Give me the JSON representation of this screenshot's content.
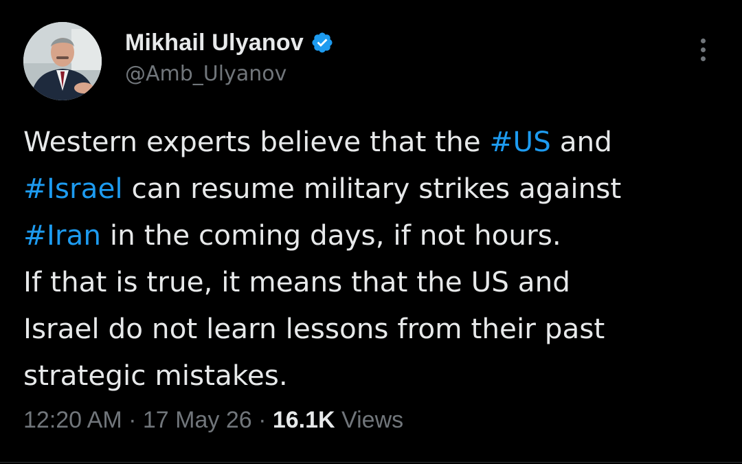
{
  "author": {
    "display_name": "Mikhail Ulyanov",
    "handle": "@Amb_Ulyanov",
    "verified_color": "#1d9bf0"
  },
  "tweet": {
    "lines": [
      [
        {
          "text": "Western experts believe that the ",
          "type": "text"
        },
        {
          "text": "#US",
          "type": "hashtag"
        },
        {
          "text": " and",
          "type": "text"
        }
      ],
      [
        {
          "text": "#Israel",
          "type": "hashtag"
        },
        {
          "text": " can resume military strikes against",
          "type": "text"
        }
      ],
      [
        {
          "text": "#Iran",
          "type": "hashtag"
        },
        {
          "text": " in the coming days, if not hours.",
          "type": "text"
        }
      ],
      [
        {
          "text": "If that is true, it means that the US and",
          "type": "text"
        }
      ],
      [
        {
          "text": "Israel do not learn lessons from their past",
          "type": "text"
        }
      ],
      [
        {
          "text": "strategic mistakes.",
          "type": "text"
        }
      ]
    ]
  },
  "meta": {
    "time": "12:20 AM",
    "separator": " · ",
    "date": "17 May 26",
    "views_count": "16.1K",
    "views_label": " Views"
  },
  "icons": {
    "verified": "verified-badge-icon",
    "more": "more-options-icon"
  },
  "colors": {
    "background": "#000000",
    "text": "#e7e9ea",
    "secondary": "#71767b",
    "accent": "#1d9bf0"
  }
}
